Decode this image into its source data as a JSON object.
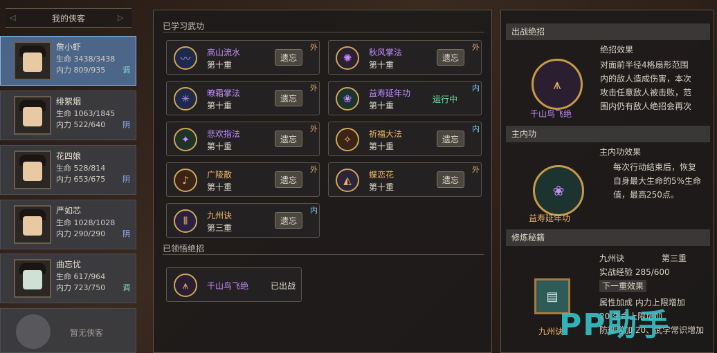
{
  "left": {
    "header": "我的侠客",
    "members": [
      {
        "name": "詹小虾",
        "hp": "生命 3438/3438",
        "mp": "内力 809/935",
        "attr": "调"
      },
      {
        "name": "绯絮烟",
        "hp": "生命 1063/1845",
        "mp": "内力 522/640",
        "attr": "阴"
      },
      {
        "name": "花四娘",
        "hp": "生命 528/814",
        "mp": "内力 653/675",
        "attr": "阴"
      },
      {
        "name": "严如芯",
        "hp": "生命 1028/1028",
        "mp": "内力 290/290",
        "attr": "阴"
      },
      {
        "name": "曲忘忧",
        "hp": "生命 617/964",
        "mp": "内力 723/750",
        "attr": "调"
      }
    ],
    "empty": "暂无侠客"
  },
  "mid": {
    "learned_title": "已学习武功",
    "forget_label": "遗忘",
    "running_label": "运行中",
    "skills": [
      {
        "name": "高山流水",
        "level": "第十重",
        "tag": "外",
        "icon": "flute-icon"
      },
      {
        "name": "秋风掌法",
        "level": "第十重",
        "tag": "外",
        "icon": "flame-palm-icon"
      },
      {
        "name": "暸霜掌法",
        "level": "第十重",
        "tag": "外",
        "icon": "frost-palm-icon"
      },
      {
        "name": "益寿延年功",
        "level": "第十重",
        "tag": "内",
        "icon": "lotus-icon"
      },
      {
        "name": "悲欢指法",
        "level": "第十重",
        "tag": "外",
        "icon": "finger-icon"
      },
      {
        "name": "祈福大法",
        "level": "第十重",
        "tag": "内",
        "icon": "blessing-icon"
      },
      {
        "name": "广陵散",
        "level": "第十重",
        "tag": "外",
        "icon": "guqin-icon"
      },
      {
        "name": "蝶恋花",
        "level": "第十重",
        "tag": "外",
        "icon": "fan-icon"
      },
      {
        "name": "九州诀",
        "level": "第三重",
        "tag": "内",
        "icon": "pillar-icon"
      }
    ],
    "ultimate_title": "已领悟绝招",
    "ultimate": {
      "name": "千山鸟飞绝",
      "status": "已出战"
    }
  },
  "right": {
    "out_title": "出战绝招",
    "out_name": "千山鸟飞绝",
    "out_effect_title": "绝招效果",
    "out_effect_lines": [
      "对面前半径4格扇形范围",
      "内的敌人造成伤害，本次",
      "攻击任意敌人被击败，范",
      "围内仍有敌人绝招会再次"
    ],
    "inner_title": "主内功",
    "inner_name": "益寿延年功",
    "inner_effect_title": "主内功效果",
    "inner_effect_lines": [
      "每次行动结束后，恢复",
      "自身最大生命的5%生命",
      "值，最高250点。"
    ],
    "cultivate_title": "修炼秘籍",
    "book_name": "九州诀",
    "book_level": "第三重",
    "book_exp": "实战经验  285/600",
    "next_effect": "下一重效果",
    "attr_lines": [
      "属性加成  内力上限增加",
      "20  生命上限增加",
      "防御增加  20、武学常识增加"
    ],
    "book_label": "九州诀",
    "watermark": "PP助手"
  }
}
